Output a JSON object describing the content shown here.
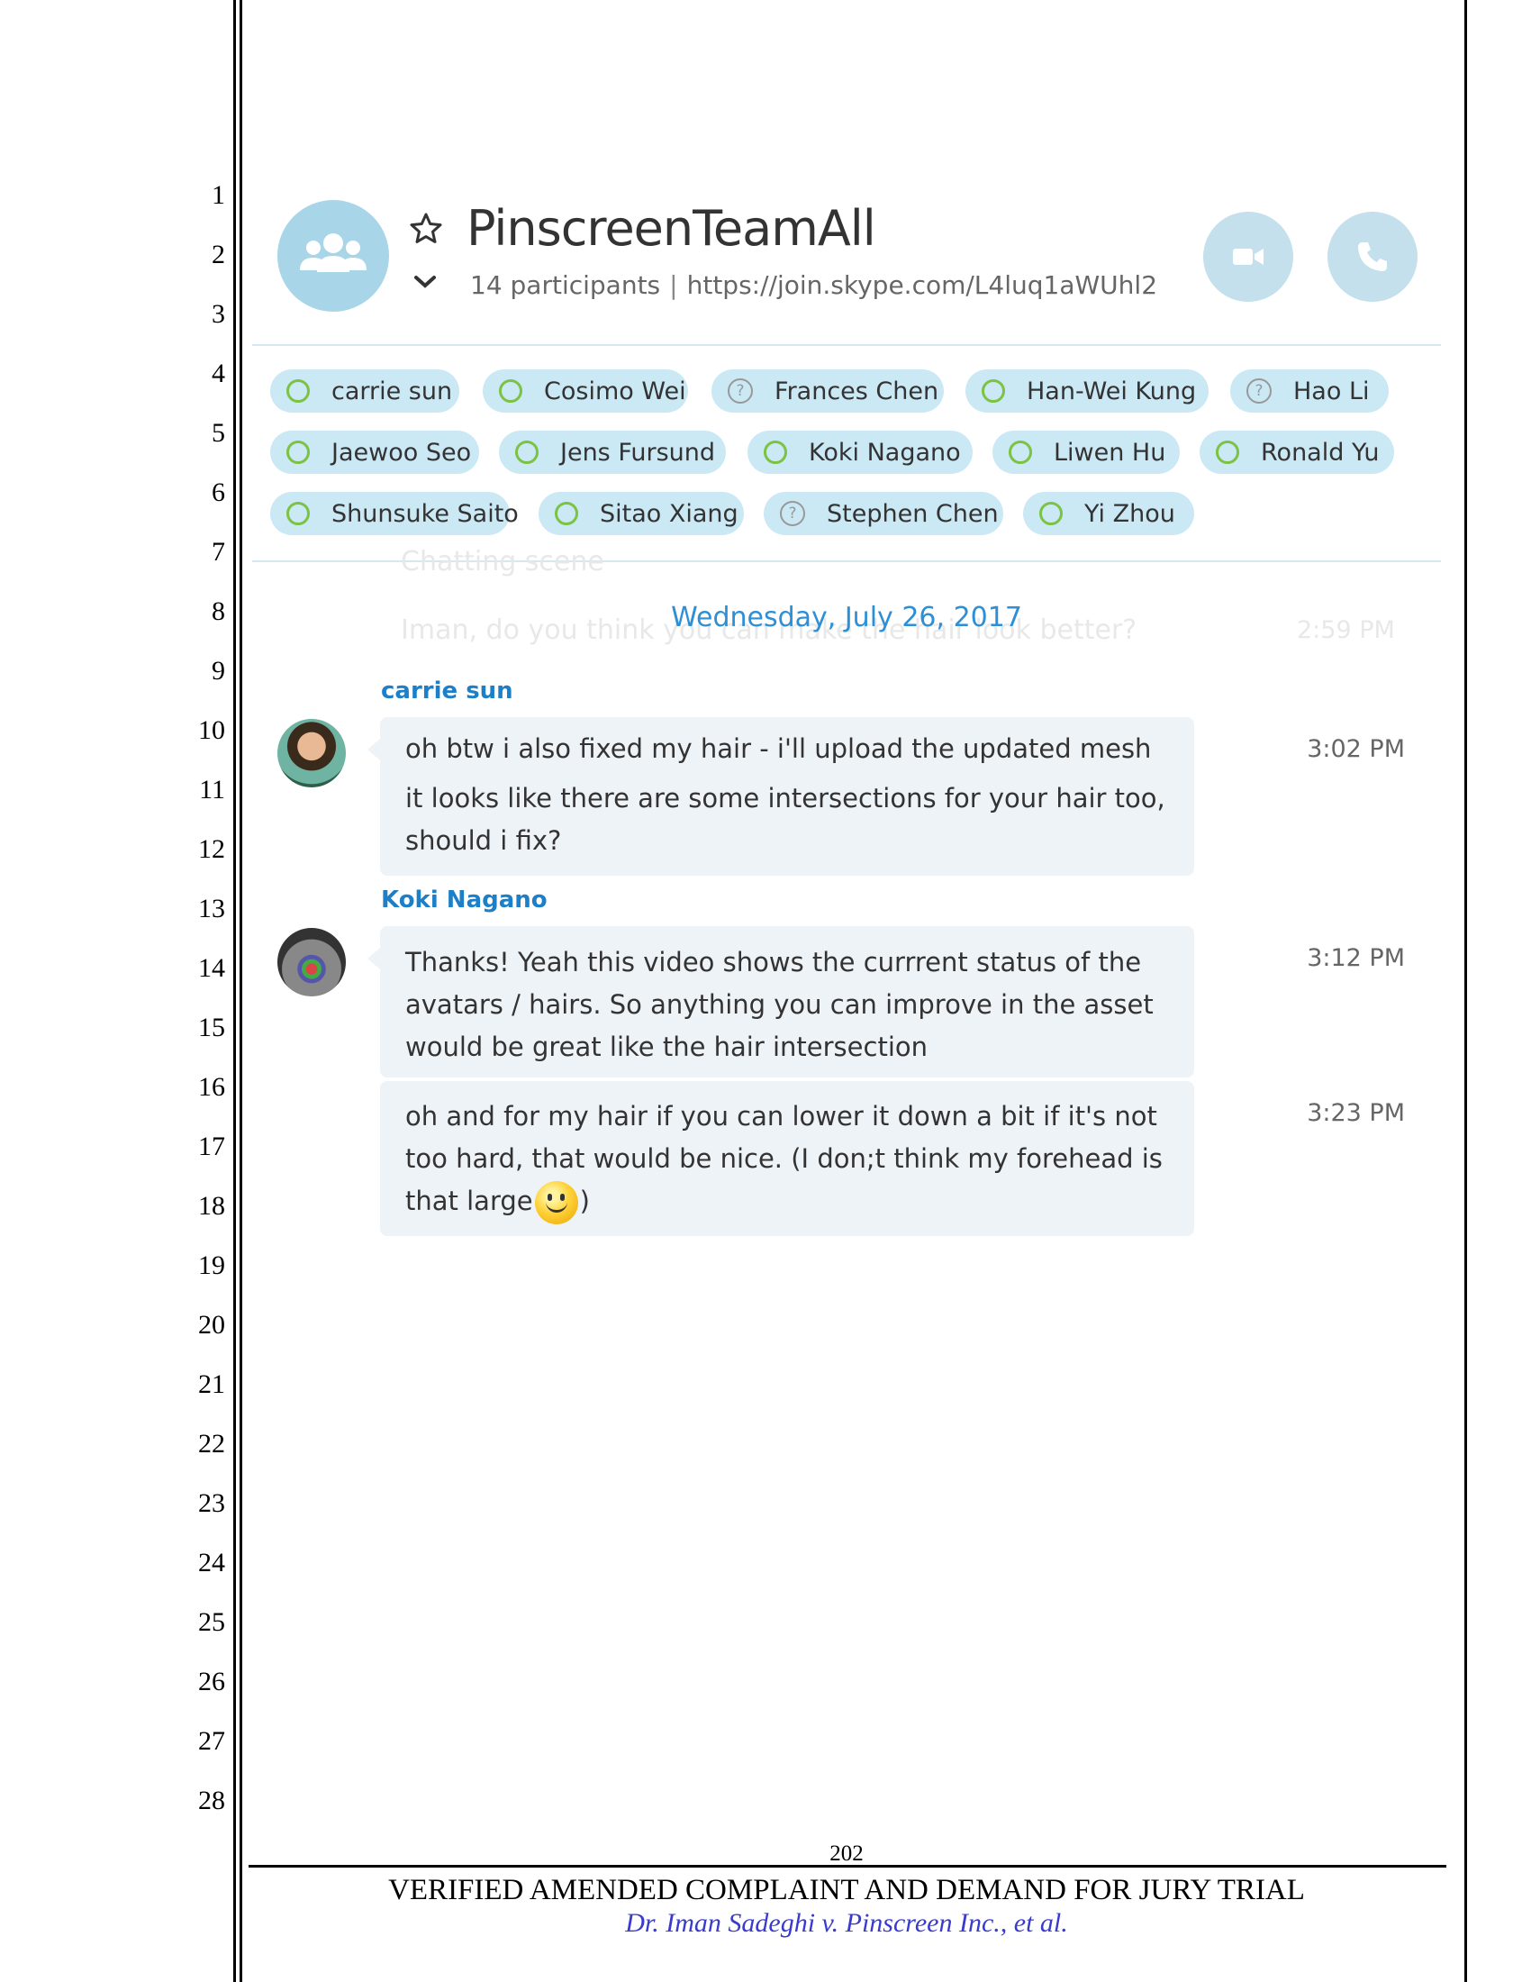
{
  "line_numbers": [
    "1",
    "2",
    "3",
    "4",
    "5",
    "6",
    "7",
    "8",
    "9",
    "10",
    "11",
    "12",
    "13",
    "14",
    "15",
    "16",
    "17",
    "18",
    "19",
    "20",
    "21",
    "22",
    "23",
    "24",
    "25",
    "26",
    "27",
    "28"
  ],
  "header": {
    "title": "PinscreenTeamAll",
    "participants_count": "14 participants",
    "separator": "|",
    "join_link": "https://join.skype.com/L4luq1aWUhl2"
  },
  "participants": [
    {
      "name": "carrie sun",
      "status": "online"
    },
    {
      "name": "Cosimo Wei",
      "status": "online"
    },
    {
      "name": "Frances Chen",
      "status": "unknown"
    },
    {
      "name": "Han-Wei Kung",
      "status": "online"
    },
    {
      "name": "Hao Li",
      "status": "unknown"
    },
    {
      "name": "Jaewoo Seo",
      "status": "online"
    },
    {
      "name": "Jens Fursund",
      "status": "online"
    },
    {
      "name": "Koki Nagano",
      "status": "online"
    },
    {
      "name": "Liwen Hu",
      "status": "online"
    },
    {
      "name": "Ronald Yu",
      "status": "online"
    },
    {
      "name": "Shunsuke Saito",
      "status": "online"
    },
    {
      "name": "Sitao Xiang",
      "status": "online"
    },
    {
      "name": "Stephen Chen",
      "status": "unknown"
    },
    {
      "name": "Yi Zhou",
      "status": "online"
    }
  ],
  "faded_background": {
    "line1": "Chatting scene",
    "line2": "Iman, do you think you can make the hair look better?",
    "time": "2:59 PM"
  },
  "date_separator": "Wednesday, July 26, 2017",
  "messages": [
    {
      "sender": "carrie sun",
      "lines": [
        "oh btw i also fixed my hair - i'll upload the updated mesh",
        "it looks like there are some intersections for your hair too,",
        "should i fix?"
      ],
      "time": "3:02 PM"
    },
    {
      "sender": "Koki Nagano",
      "lines": [
        "Thanks! Yeah this video shows the currrent status of the",
        "avatars / hairs. So anything you can improve in the asset",
        "would be great like the hair intersection"
      ],
      "time": "3:12 PM"
    },
    {
      "lines": [
        "oh and for my hair if you can lower it down a bit if it's not",
        "too hard, that would be nice. (I don;t think my forehead is",
        "that large",
        ")"
      ],
      "time": "3:23 PM"
    }
  ],
  "colors": {
    "accent": "#1c7fc7",
    "chip": "#cbe8f5",
    "bubble": "#eef3f8",
    "online": "#7cc243"
  },
  "footer": {
    "page_number": "202",
    "title": "VERIFIED AMENDED COMPLAINT AND DEMAND FOR JURY TRIAL",
    "case": "Dr. Iman Sadeghi v. Pinscreen Inc., et al."
  }
}
